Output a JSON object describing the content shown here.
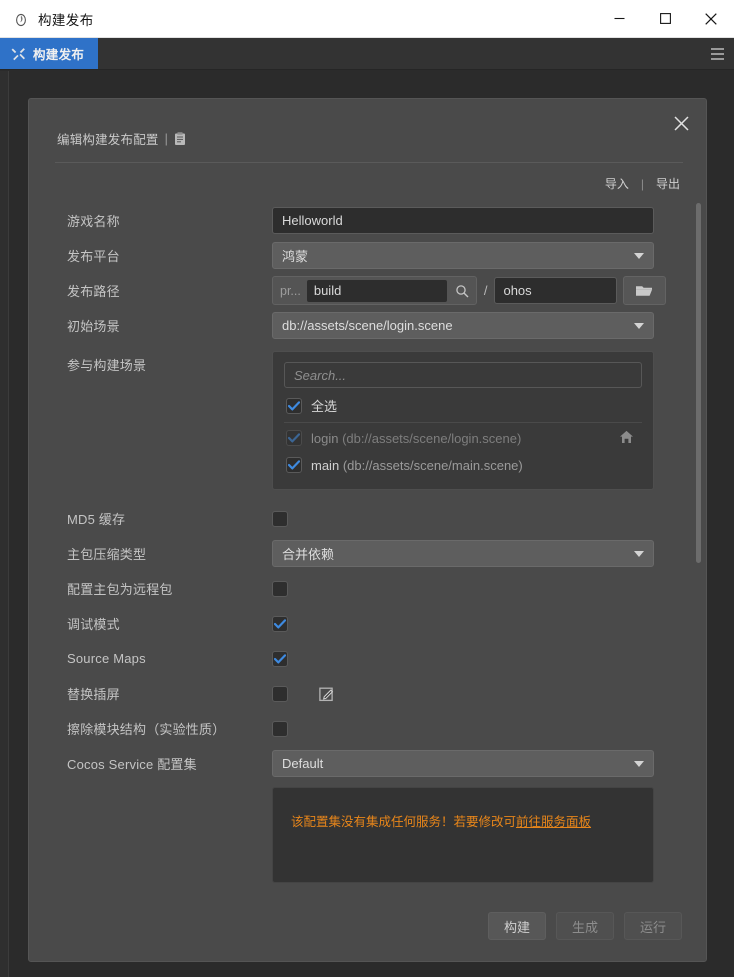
{
  "window": {
    "title": "构建发布",
    "app_icon": "flame-icon",
    "minimize": "minimize-icon",
    "maximize": "maximize-icon",
    "close": "close-icon"
  },
  "tabstrip": {
    "active_tab": "构建发布",
    "tab_icon": "tools-icon",
    "menu_icon": "hamburger-icon"
  },
  "dialog": {
    "head_title": "编辑构建发布配置",
    "head_separator": "|",
    "head_icon": "clipboard-icon",
    "close_icon": "close-icon",
    "import_label": "导入",
    "io_separator": "|",
    "export_label": "导出"
  },
  "form": {
    "game_name": {
      "label": "游戏名称",
      "value": "Helloworld"
    },
    "platform": {
      "label": "发布平台",
      "value": "鸿蒙"
    },
    "build_path": {
      "label": "发布路径",
      "prefix": "pr...",
      "folder_value": "build",
      "search_icon": "search-icon",
      "slash": "/",
      "sub_value": "ohos",
      "browse_icon": "folder-icon"
    },
    "start_scene": {
      "label": "初始场景",
      "value": "db://assets/scene/login.scene"
    },
    "scenes": {
      "label": "参与构建场景",
      "search_placeholder": "Search...",
      "search_value": "",
      "select_all_label": "全选",
      "select_all_checked": true,
      "items": [
        {
          "name": "login",
          "path": "(db://assets/scene/login.scene)",
          "checked": true,
          "disabled": true,
          "home_icon": "home-icon"
        },
        {
          "name": "main",
          "path": "(db://assets/scene/main.scene)",
          "checked": true,
          "disabled": false,
          "home_icon": ""
        }
      ]
    },
    "md5_cache": {
      "label": "MD5 缓存",
      "checked": false
    },
    "bundle_compression": {
      "label": "主包压缩类型",
      "value": "合并依赖"
    },
    "main_bundle_remote": {
      "label": "配置主包为远程包",
      "checked": false
    },
    "debug_mode": {
      "label": "调试模式",
      "checked": true
    },
    "source_maps": {
      "label": "Source Maps",
      "checked": true
    },
    "replace_splash": {
      "label": "替换插屏",
      "checked": false,
      "edit_icon": "edit-square-icon"
    },
    "erase_module": {
      "label": "擦除模块结构（实验性质）",
      "checked": false
    },
    "cocos_service": {
      "label": "Cocos Service 配置集",
      "value": "Default"
    },
    "service_warning": {
      "text": "该配置集没有集成任何服务！若要修改可",
      "link": "前往服务面板"
    }
  },
  "footer": {
    "build_label": "构建",
    "generate_label": "生成",
    "run_label": "运行",
    "build_enabled": true,
    "generate_enabled": false,
    "run_enabled": false
  },
  "colors": {
    "accent_blue": "#2f72c8",
    "warning_orange": "#e8861a",
    "checkbox_blue": "#3e8ae0",
    "panel_bg": "#4a4a4a",
    "app_bg": "#2b2b2b"
  }
}
